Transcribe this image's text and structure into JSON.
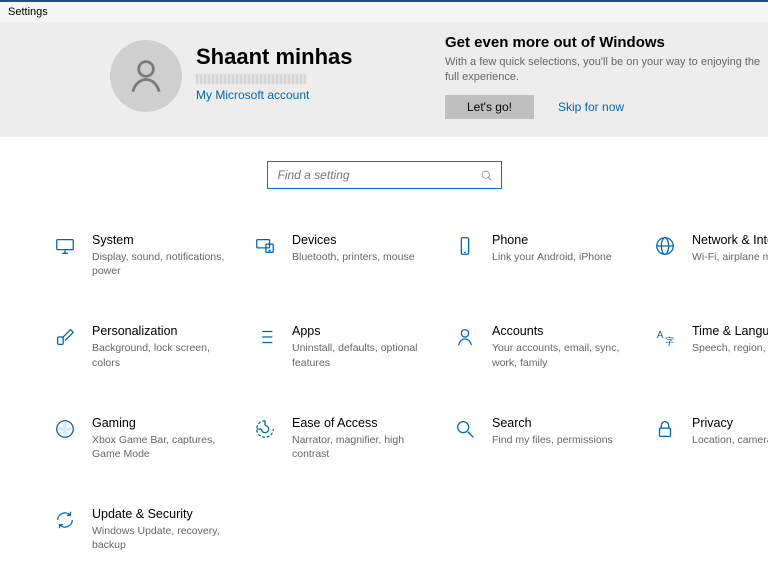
{
  "window": {
    "title": "Settings"
  },
  "user": {
    "name": "Shaant minhas",
    "account_link": "My Microsoft account"
  },
  "promo": {
    "title": "Get even more out of Windows",
    "text": "With a few quick selections, you'll be on your way to enjoying the full experience.",
    "button": "Let's go!",
    "skip": "Skip for now"
  },
  "search": {
    "placeholder": "Find a setting"
  },
  "categories": [
    {
      "id": "system",
      "title": "System",
      "desc": "Display, sound, notifications, power"
    },
    {
      "id": "devices",
      "title": "Devices",
      "desc": "Bluetooth, printers, mouse"
    },
    {
      "id": "phone",
      "title": "Phone",
      "desc": "Link your Android, iPhone"
    },
    {
      "id": "network",
      "title": "Network & Internet",
      "desc": "Wi-Fi, airplane mode"
    },
    {
      "id": "personalization",
      "title": "Personalization",
      "desc": "Background, lock screen, colors"
    },
    {
      "id": "apps",
      "title": "Apps",
      "desc": "Uninstall, defaults, optional features"
    },
    {
      "id": "accounts",
      "title": "Accounts",
      "desc": "Your accounts, email, sync, work, family"
    },
    {
      "id": "time-language",
      "title": "Time & Language",
      "desc": "Speech, region, date"
    },
    {
      "id": "gaming",
      "title": "Gaming",
      "desc": "Xbox Game Bar, captures, Game Mode"
    },
    {
      "id": "ease-of-access",
      "title": "Ease of Access",
      "desc": "Narrator, magnifier, high contrast"
    },
    {
      "id": "search",
      "title": "Search",
      "desc": "Find my files, permissions"
    },
    {
      "id": "privacy",
      "title": "Privacy",
      "desc": "Location, camera,"
    },
    {
      "id": "update-security",
      "title": "Update & Security",
      "desc": "Windows Update, recovery, backup"
    }
  ],
  "colors": {
    "accent": "#0066b4",
    "border": "#0078d4"
  }
}
